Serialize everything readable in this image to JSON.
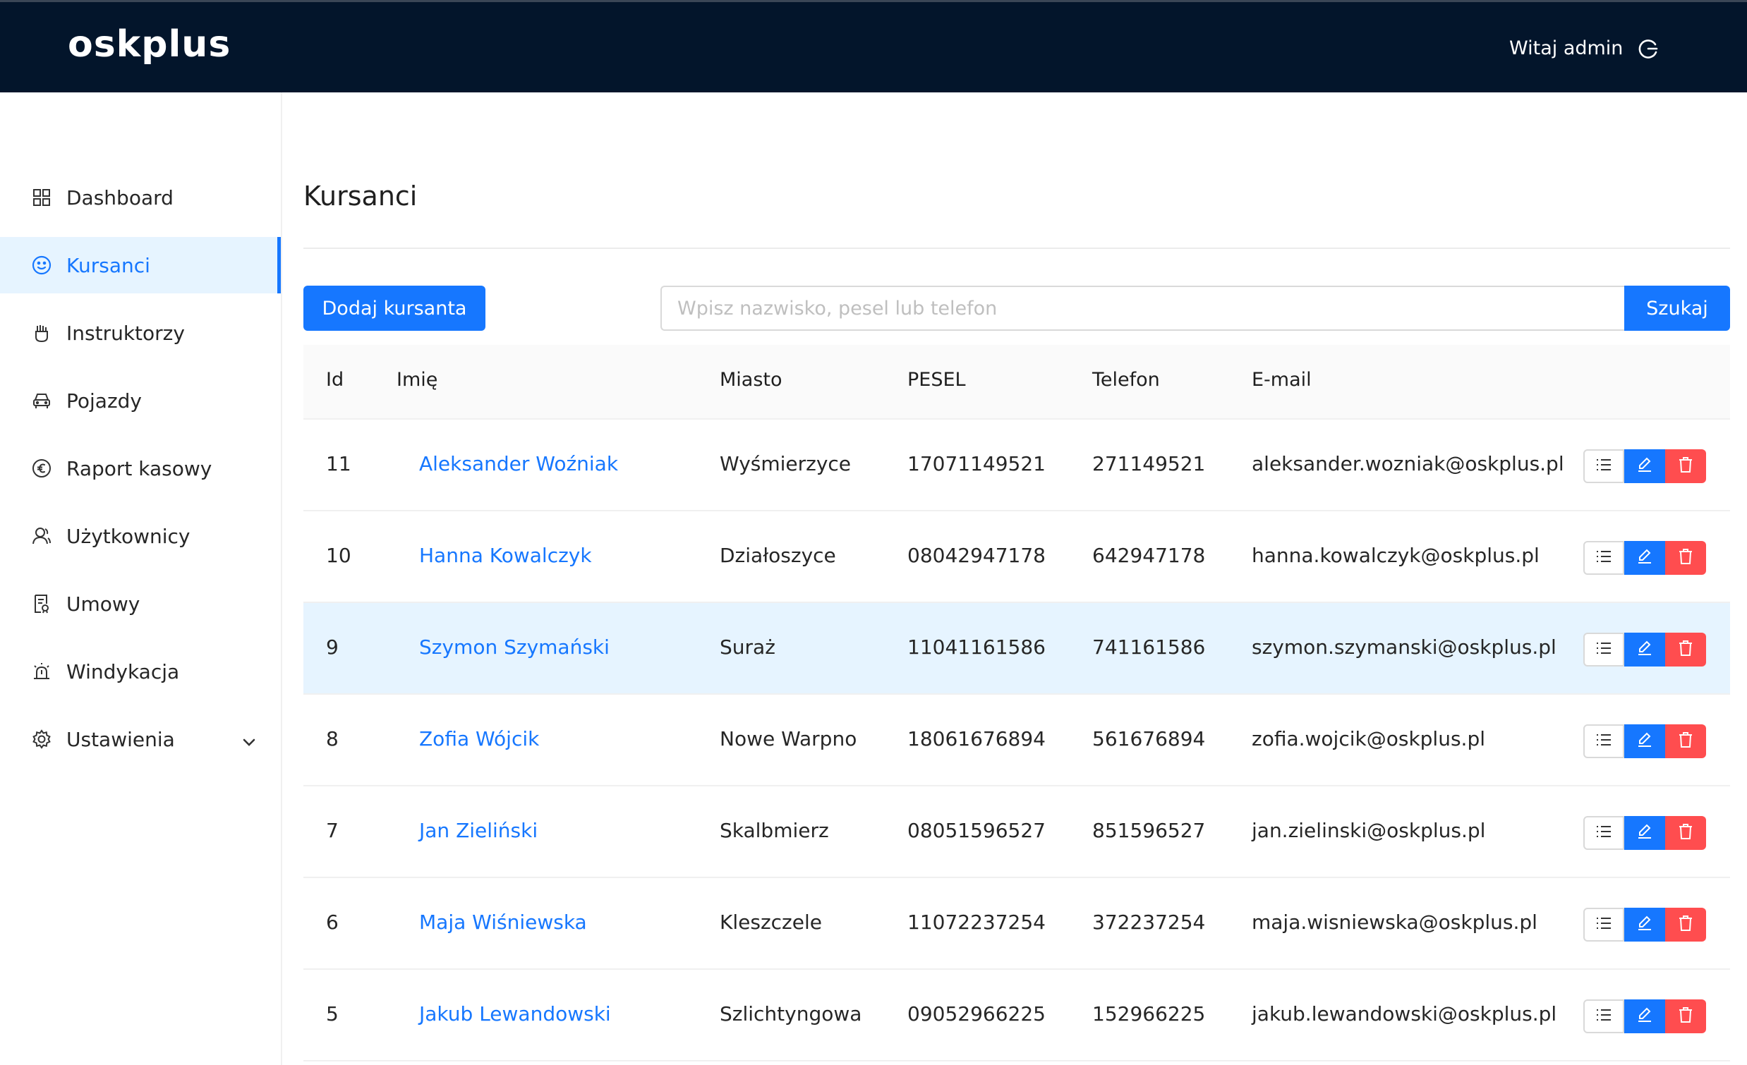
{
  "header": {
    "logo": "oskplus",
    "greeting": "Witaj admin",
    "logout_icon": "logout-icon"
  },
  "sidebar": {
    "items": [
      {
        "label": "Dashboard",
        "icon": "dashboard-icon",
        "active": false
      },
      {
        "label": "Kursanci",
        "icon": "smile-icon",
        "active": true
      },
      {
        "label": "Instruktorzy",
        "icon": "instructor-icon",
        "active": false
      },
      {
        "label": "Pojazdy",
        "icon": "car-icon",
        "active": false
      },
      {
        "label": "Raport kasowy",
        "icon": "euro-icon",
        "active": false
      },
      {
        "label": "Użytkownicy",
        "icon": "users-icon",
        "active": false
      },
      {
        "label": "Umowy",
        "icon": "contract-icon",
        "active": false
      },
      {
        "label": "Windykacja",
        "icon": "alarm-icon",
        "active": false
      },
      {
        "label": "Ustawienia",
        "icon": "settings-icon",
        "active": false,
        "expandable": true
      }
    ]
  },
  "main": {
    "title": "Kursanci",
    "add_button": "Dodaj kursanta",
    "search_placeholder": "Wpisz nazwisko, pesel lub telefon",
    "search_button": "Szukaj"
  },
  "table": {
    "columns": [
      "Id",
      "Imię",
      "Miasto",
      "PESEL",
      "Telefon",
      "E-mail"
    ],
    "rows": [
      {
        "id": "11",
        "name": "Aleksander Woźniak",
        "city": "Wyśmierzyce",
        "pesel": "17071149521",
        "phone": "271149521",
        "email": "aleksander.wozniak@oskplus.pl",
        "highlight": false
      },
      {
        "id": "10",
        "name": "Hanna Kowalczyk",
        "city": "Działoszyce",
        "pesel": "08042947178",
        "phone": "642947178",
        "email": "hanna.kowalczyk@oskplus.pl",
        "highlight": false
      },
      {
        "id": "9",
        "name": "Szymon Szymański",
        "city": "Suraż",
        "pesel": "11041161586",
        "phone": "741161586",
        "email": "szymon.szymanski@oskplus.pl",
        "highlight": true
      },
      {
        "id": "8",
        "name": "Zofia Wójcik",
        "city": "Nowe Warpno",
        "pesel": "18061676894",
        "phone": "561676894",
        "email": "zofia.wojcik@oskplus.pl",
        "highlight": false
      },
      {
        "id": "7",
        "name": "Jan Zieliński",
        "city": "Skalbmierz",
        "pesel": "08051596527",
        "phone": "851596527",
        "email": "jan.zielinski@oskplus.pl",
        "highlight": false
      },
      {
        "id": "6",
        "name": "Maja Wiśniewska",
        "city": "Kleszczele",
        "pesel": "11072237254",
        "phone": "372237254",
        "email": "maja.wisniewska@oskplus.pl",
        "highlight": false
      },
      {
        "id": "5",
        "name": "Jakub Lewandowski",
        "city": "Szlichtyngowa",
        "pesel": "09052966225",
        "phone": "152966225",
        "email": "jakub.lewandowski@oskplus.pl",
        "highlight": false
      }
    ]
  },
  "colors": {
    "topbar": "#03152b",
    "primary": "#1677ff",
    "danger": "#ff4d4f",
    "active_bg": "#e6f4ff"
  }
}
